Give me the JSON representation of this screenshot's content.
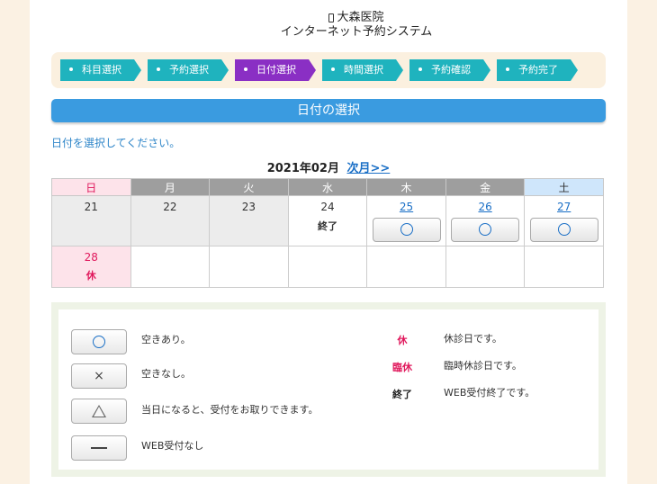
{
  "header": {
    "clinic_name": "大森医院",
    "system_name": "インターネット予約システム"
  },
  "steps": [
    {
      "label": "科目選択",
      "active": false
    },
    {
      "label": "予約選択",
      "active": false
    },
    {
      "label": "日付選択",
      "active": true
    },
    {
      "label": "時間選択",
      "active": false
    },
    {
      "label": "予約確認",
      "active": false
    },
    {
      "label": "予約完了",
      "active": false
    }
  ],
  "section_title": "日付の選択",
  "instruction": "日付を選択してください。",
  "calendar": {
    "month_label": "2021年02月",
    "next_month_link": "次月>>",
    "weekdays": [
      "日",
      "月",
      "火",
      "水",
      "木",
      "金",
      "土"
    ],
    "row1": [
      {
        "day": "21",
        "status": ""
      },
      {
        "day": "22",
        "status": ""
      },
      {
        "day": "23",
        "status": ""
      },
      {
        "day": "24",
        "status": "終了"
      },
      {
        "day": "25",
        "status": "○"
      },
      {
        "day": "26",
        "status": "○"
      },
      {
        "day": "27",
        "status": "○"
      }
    ],
    "row2": [
      {
        "day": "28",
        "status": "休"
      }
    ]
  },
  "legend": {
    "available": "空きあり。",
    "full": "空きなし。",
    "same_day": "当日になると、受付をお取りできます。",
    "no_web": "WEB受付なし",
    "holiday_mark": "休",
    "holiday_desc": "休診日です。",
    "temp_holiday_mark": "臨休",
    "temp_holiday_desc": "臨時休診日です。",
    "closed_mark": "終了",
    "closed_desc": "WEB受付終了です。",
    "full_symbol": "×"
  },
  "colors": {
    "accent_blue": "#3a9be0",
    "step_teal": "#1fb3be",
    "step_active": "#8a2fc4",
    "holiday_pink": "#e0185c"
  }
}
